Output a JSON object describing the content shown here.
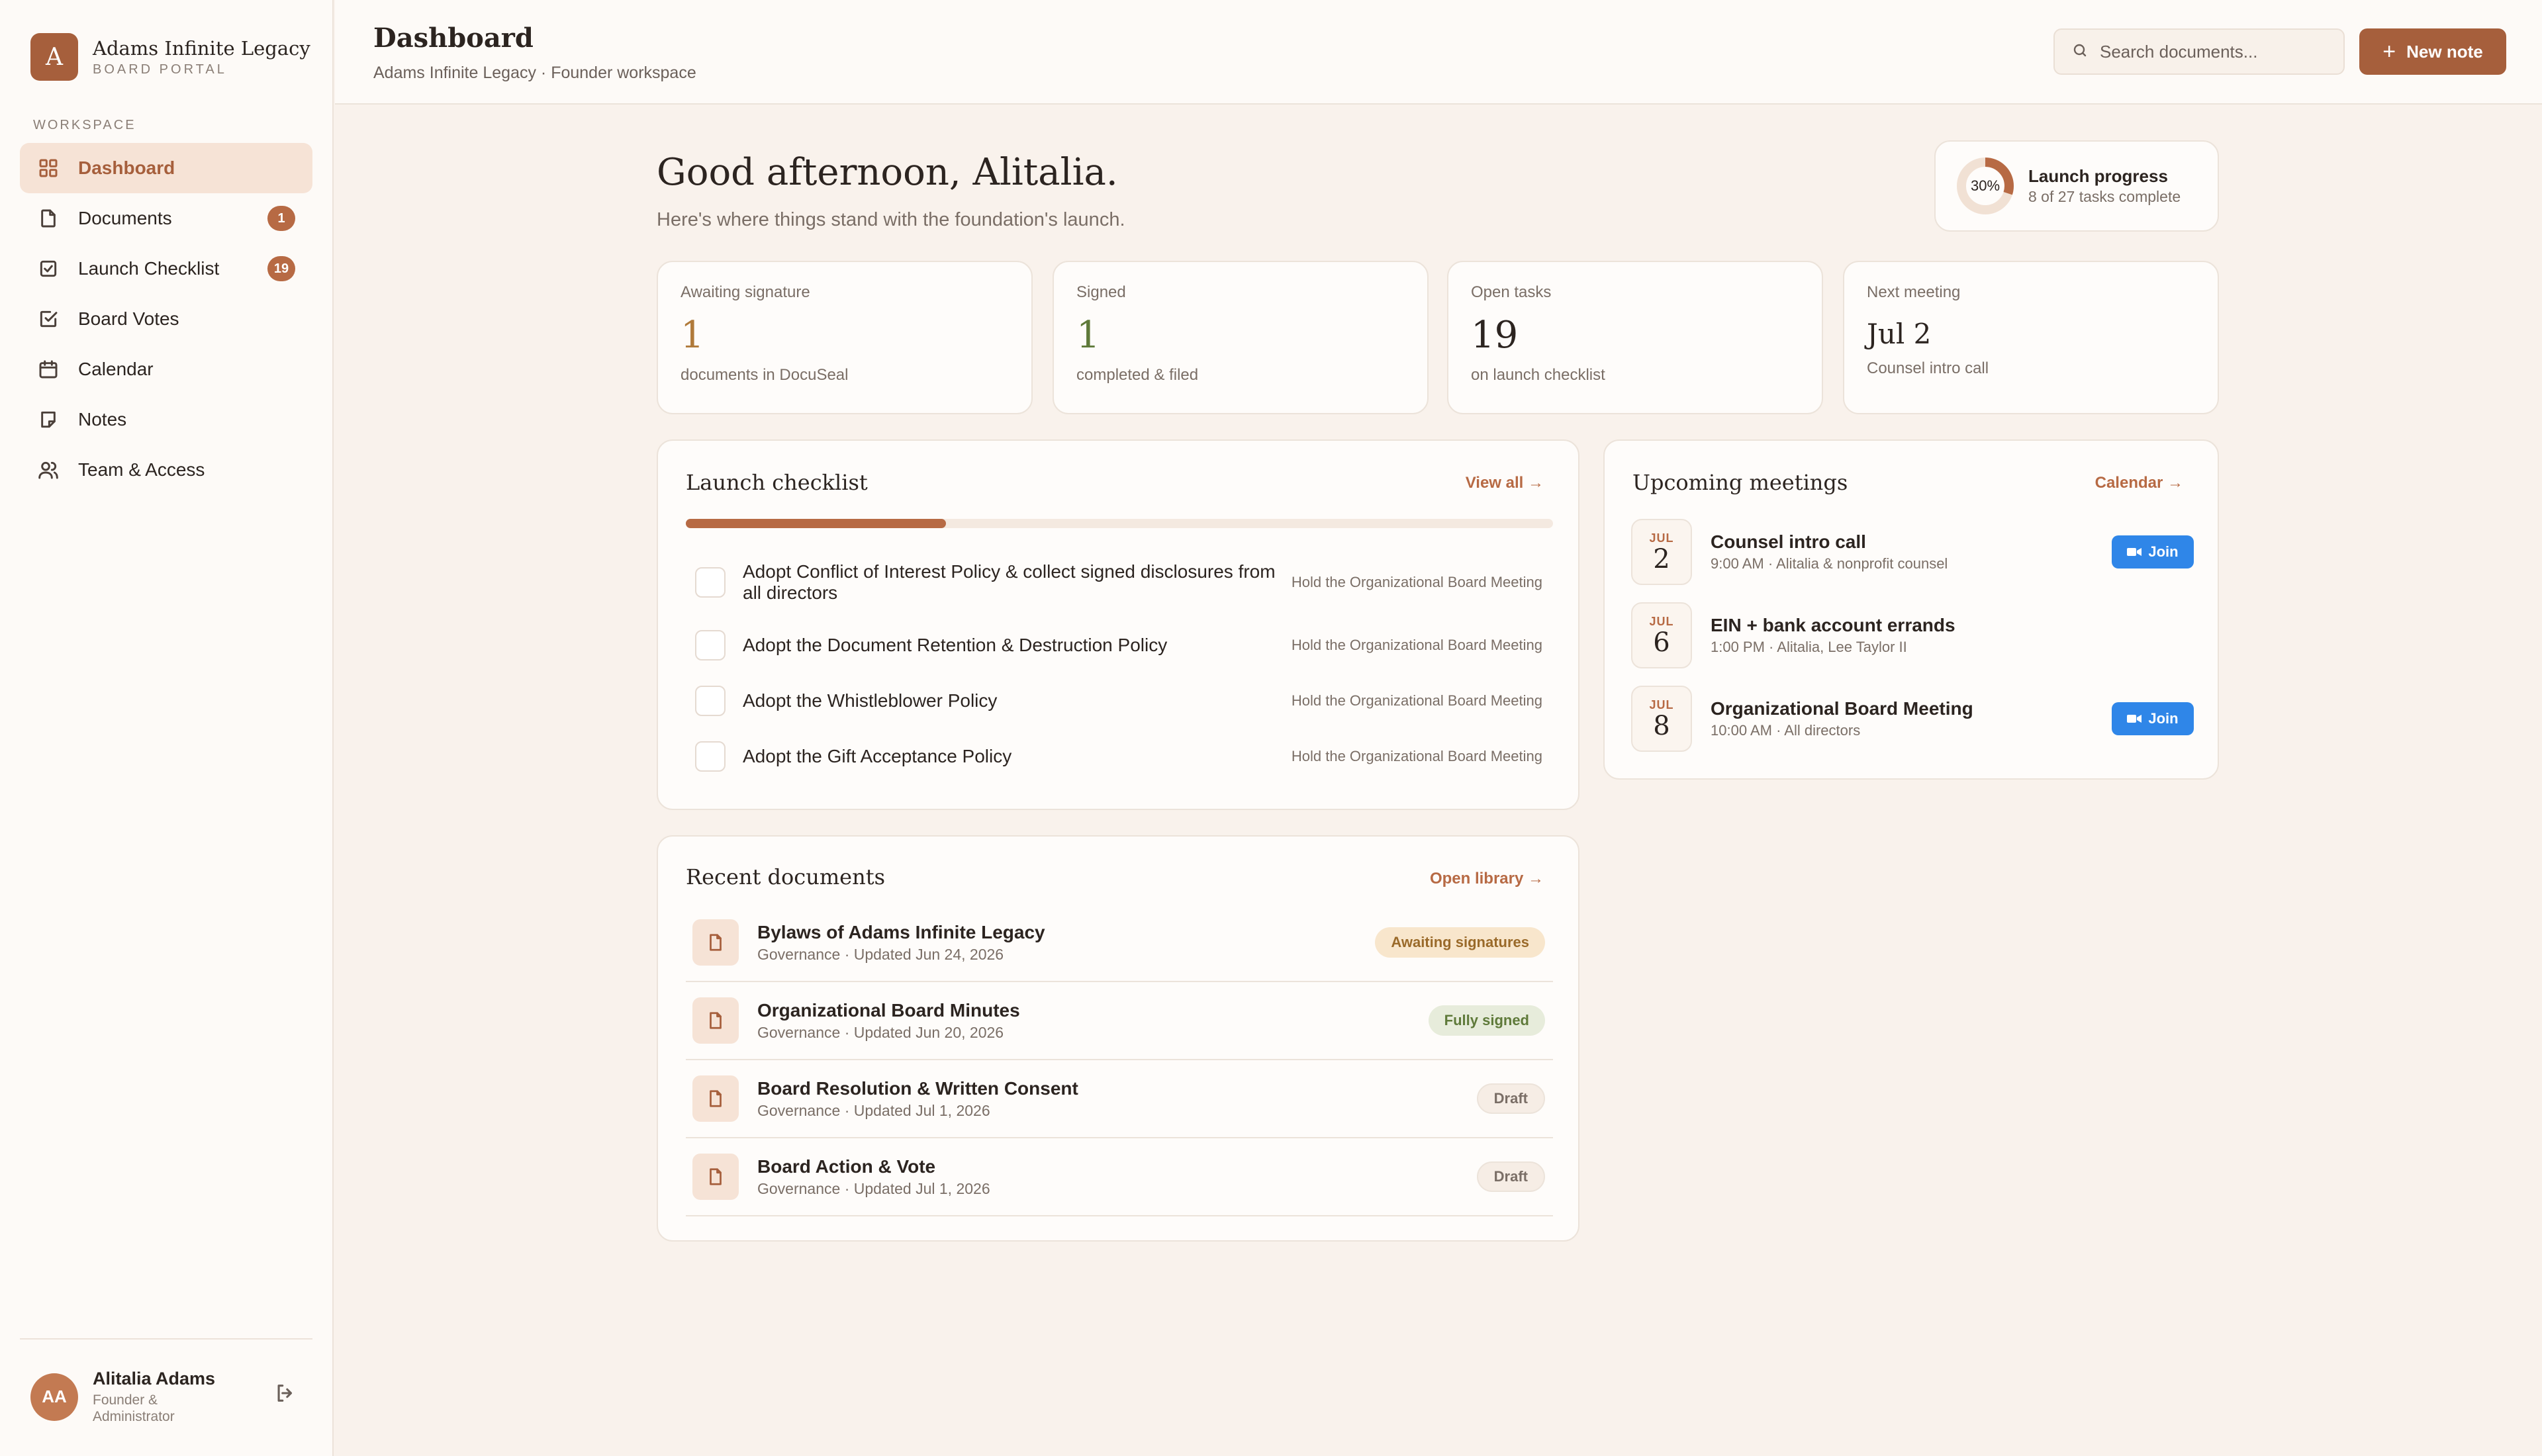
{
  "app": {
    "name": "Adams Infinite Legacy",
    "subtitle": "BOARD PORTAL",
    "logo_letter": "A"
  },
  "sidebar": {
    "section_label": "WORKSPACE",
    "items": [
      {
        "label": "Dashboard",
        "icon": "grid-icon",
        "active": true
      },
      {
        "label": "Documents",
        "icon": "file-icon",
        "badge": "1"
      },
      {
        "label": "Launch Checklist",
        "icon": "checkbox-icon",
        "badge": "19"
      },
      {
        "label": "Board Votes",
        "icon": "vote-icon"
      },
      {
        "label": "Calendar",
        "icon": "calendar-icon"
      },
      {
        "label": "Notes",
        "icon": "note-icon"
      },
      {
        "label": "Team & Access",
        "icon": "users-icon"
      }
    ],
    "user": {
      "initials": "AA",
      "name": "Alitalia Adams",
      "role": "Founder & Administrator"
    }
  },
  "header": {
    "title": "Dashboard",
    "subtitle": "Adams Infinite Legacy · Founder workspace",
    "search_placeholder": "Search documents...",
    "new_note_label": "New note"
  },
  "greeting": {
    "title": "Good afternoon, Alitalia.",
    "subtitle": "Here's where things stand with the foundation's launch."
  },
  "launch_progress": {
    "percent_label": "30%",
    "percent": 30,
    "title": "Launch progress",
    "subtitle": "8 of 27 tasks complete"
  },
  "stats": [
    {
      "label": "Awaiting signature",
      "value": "1",
      "caption": "documents in DocuSeal",
      "color": "#b07a3a"
    },
    {
      "label": "Signed",
      "value": "1",
      "caption": "completed & filed",
      "color": "#5f7a3a"
    },
    {
      "label": "Open tasks",
      "value": "19",
      "caption": "on launch checklist",
      "color": "#2c2420"
    },
    {
      "label": "Next meeting",
      "value": "Jul 2",
      "caption": "Counsel intro call",
      "color": "#2c2420"
    }
  ],
  "checklist": {
    "title": "Launch checklist",
    "link": "View all →",
    "progress": 0.3,
    "items": [
      {
        "text": "Adopt Conflict of Interest Policy & collect signed disclosures from all directors",
        "tag": "Hold the Organizational Board Meeting"
      },
      {
        "text": "Adopt the Document Retention & Destruction Policy",
        "tag": "Hold the Organizational Board Meeting"
      },
      {
        "text": "Adopt the Whistleblower Policy",
        "tag": "Hold the Organizational Board Meeting"
      },
      {
        "text": "Adopt the Gift Acceptance Policy",
        "tag": "Hold the Organizational Board Meeting"
      }
    ]
  },
  "meetings": {
    "title": "Upcoming meetings",
    "link": "Calendar →",
    "join_label": "Join",
    "items": [
      {
        "month": "JUL",
        "day": "2",
        "title": "Counsel intro call",
        "sub": "9:00 AM · Alitalia & nonprofit counsel",
        "join": true
      },
      {
        "month": "JUL",
        "day": "6",
        "title": "EIN + bank account errands",
        "sub": "1:00 PM · Alitalia, Lee Taylor II",
        "join": false
      },
      {
        "month": "JUL",
        "day": "8",
        "title": "Organizational Board Meeting",
        "sub": "10:00 AM · All directors",
        "join": true
      }
    ]
  },
  "documents": {
    "title": "Recent documents",
    "link": "Open library →",
    "items": [
      {
        "title": "Bylaws of Adams Infinite Legacy",
        "sub": "Governance · Updated Jun 24, 2026",
        "status": "Awaiting signatures",
        "kind": "awaiting"
      },
      {
        "title": "Organizational Board Minutes",
        "sub": "Governance · Updated Jun 20, 2026",
        "status": "Fully signed",
        "kind": "signed"
      },
      {
        "title": "Board Resolution & Written Consent",
        "sub": "Governance · Updated Jul 1, 2026",
        "status": "Draft",
        "kind": "draft"
      },
      {
        "title": "Board Action & Vote",
        "sub": "Governance · Updated Jul 1, 2026",
        "status": "Draft",
        "kind": "draft"
      }
    ]
  },
  "colors": {
    "accent": "#a65f3c",
    "accent_soft": "#f6e3d6",
    "background": "#f9f2ec",
    "join_blue": "#2f86e8"
  }
}
